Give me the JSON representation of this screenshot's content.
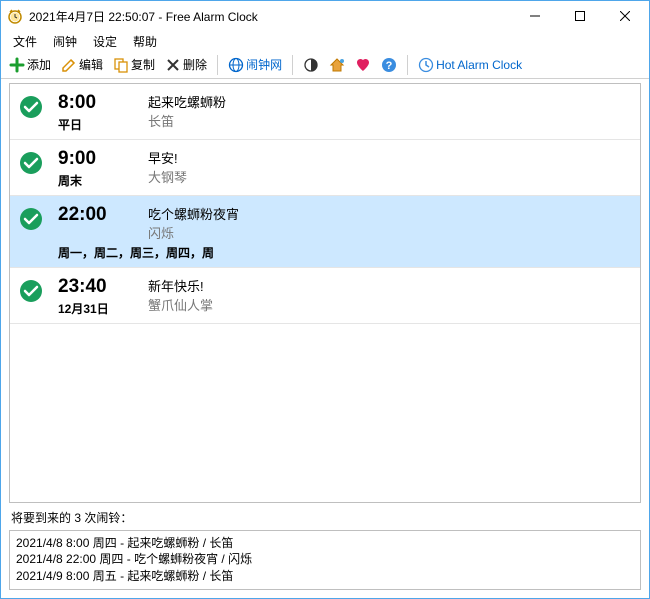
{
  "title": "2021年4月7日 22:50:07 - Free Alarm Clock",
  "menu": {
    "file": "文件",
    "alarm": "闹钟",
    "settings": "设定",
    "help": "帮助"
  },
  "toolbar": {
    "add": "添加",
    "edit": "编辑",
    "copy": "复制",
    "delete": "删除",
    "website": "闹钟网",
    "hotalarm": "Hot Alarm Clock"
  },
  "alarms": [
    {
      "time": "8:00",
      "days": "平日",
      "desc1": "起来吃螺蛳粉",
      "desc2": "长笛",
      "selected": false
    },
    {
      "time": "9:00",
      "days": "周末",
      "desc1": "早安!",
      "desc2": "大钢琴",
      "selected": false
    },
    {
      "time": "22:00",
      "days": "周一，周二，周三，周四，周",
      "desc1": "吃个螺蛳粉夜宵",
      "desc2": "闪烁",
      "selected": true
    },
    {
      "time": "23:40",
      "days": "12月31日",
      "desc1": "新年快乐!",
      "desc2": "蟹爪仙人掌",
      "selected": false
    }
  ],
  "upcoming": {
    "label": "将要到来的 3 次闹铃：",
    "items": [
      "2021/4/8 8:00 周四 - 起来吃螺蛳粉 / 长笛",
      "2021/4/8 22:00 周四 - 吃个螺蛳粉夜宵 / 闪烁",
      "2021/4/9 8:00 周五 - 起来吃螺蛳粉 / 长笛"
    ]
  }
}
